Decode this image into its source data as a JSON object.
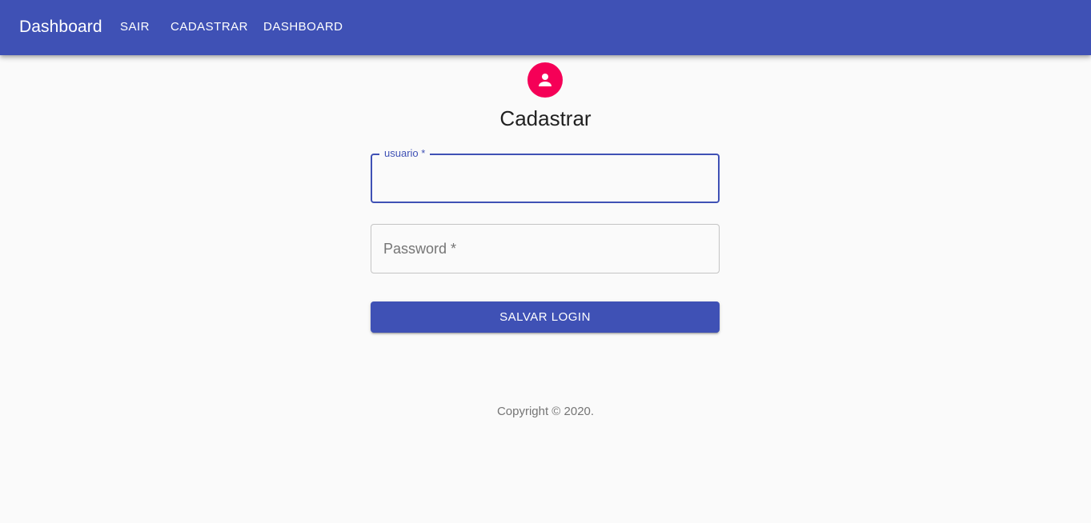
{
  "appbar": {
    "title": "Dashboard",
    "nav": {
      "sair": "SAIR",
      "cadastrar": "CADASTRAR",
      "dashboard": "DASHBOARD"
    },
    "color": "#3f51b5"
  },
  "form": {
    "avatar_icon": "person-icon",
    "avatar_color": "#f50057",
    "title": "Cadastrar",
    "usuario": {
      "label": "usuario *",
      "value": ""
    },
    "password": {
      "label": "Password *",
      "value": ""
    },
    "submit_label": "SALVAR LOGIN"
  },
  "footer": {
    "copyright": "Copyright © 2020."
  }
}
